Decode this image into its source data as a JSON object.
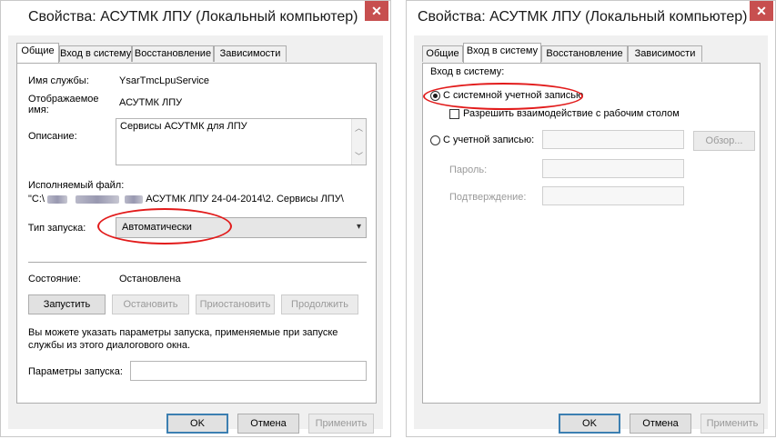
{
  "window1": {
    "title": "Свойства: АСУТМК ЛПУ (Локальный компьютер)",
    "close_glyph": "✕",
    "tabs": [
      {
        "label": "Общие",
        "active": true
      },
      {
        "label": "Вход в систему",
        "active": false
      },
      {
        "label": "Восстановление",
        "active": false
      },
      {
        "label": "Зависимости",
        "active": false
      }
    ],
    "service_name_label": "Имя службы:",
    "service_name_value": "YsarTmcLpuService",
    "display_name_label_1": "Отображаемое",
    "display_name_label_2": "имя:",
    "display_name_value": "АСУТМК ЛПУ",
    "description_label": "Описание:",
    "description_value": "Сервисы АСУТМК для ЛПУ",
    "exe_label": "Исполняемый файл:",
    "exe_prefix": "\"C:\\",
    "exe_value": "АСУТМК ЛПУ 24-04-2014\\2. Сервисы ЛПУ\\",
    "startup_type_label": "Тип запуска:",
    "startup_type_value": "Автоматически",
    "status_label": "Состояние:",
    "status_value": "Остановлена",
    "buttons": {
      "start": "Запустить",
      "stop": "Остановить",
      "pause": "Приостановить",
      "resume": "Продолжить"
    },
    "hint_line1": "Вы можете указать параметры запуска, применяемые при запуске",
    "hint_line2": "службы из этого диалогового окна.",
    "params_label": "Параметры запуска:",
    "params_value": "",
    "ok": "OK",
    "cancel": "Отмена",
    "apply": "Применить"
  },
  "window2": {
    "title": "Свойства: АСУТМК ЛПУ (Локальный компьютер)",
    "close_glyph": "✕",
    "tabs": [
      {
        "label": "Общие",
        "active": false
      },
      {
        "label": "Вход в систему",
        "active": true
      },
      {
        "label": "Восстановление",
        "active": false
      },
      {
        "label": "Зависимости",
        "active": false
      }
    ],
    "logon_as_label": "Вход в систему:",
    "system_account_label": "С системной учетной записью",
    "system_account_selected": true,
    "allow_desktop_label": "Разрешить взаимодействие с рабочим столом",
    "allow_desktop_checked": false,
    "this_account_label": "С учетной записью:",
    "this_account_value": "",
    "browse_label": "Обзор...",
    "password_label": "Пароль:",
    "password_value": "",
    "confirm_label": "Подтверждение:",
    "confirm_value": "",
    "ok": "OK",
    "cancel": "Отмена",
    "apply": "Применить"
  },
  "colors": {
    "annotation": "#e21b1b",
    "close_button": "#c74f4f",
    "default_button_border": "#3c7fb1",
    "dialog_background": "#f0f0f0"
  }
}
